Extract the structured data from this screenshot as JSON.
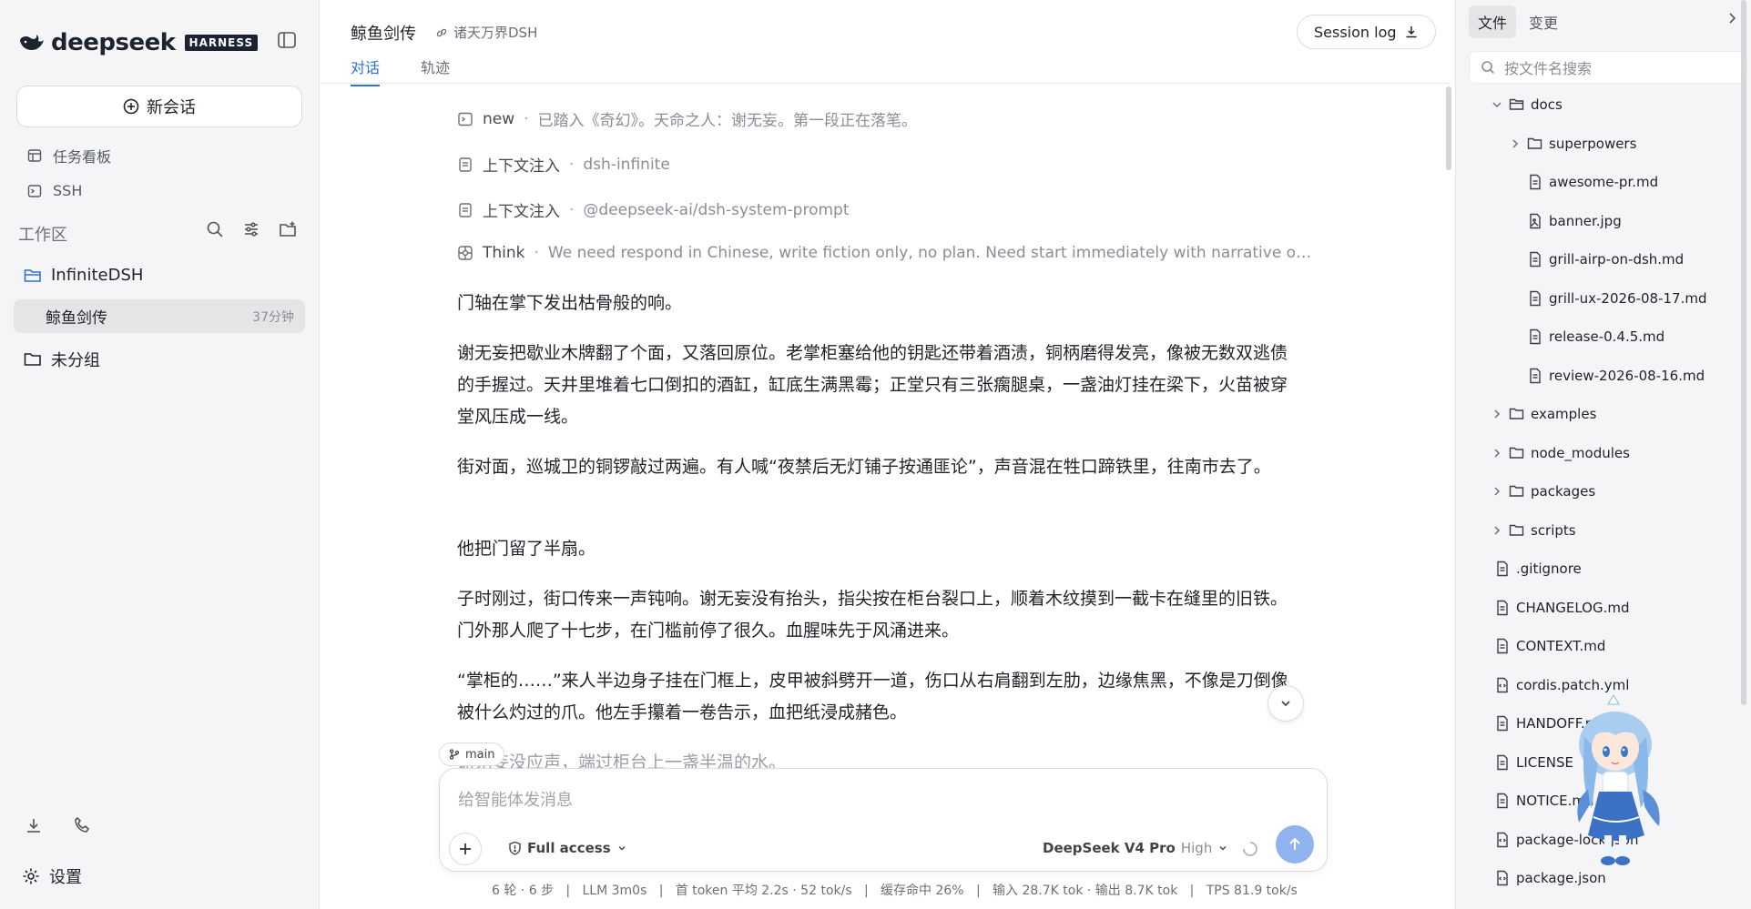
{
  "brand": {
    "name": "deepseek",
    "tag": "HARNESS"
  },
  "sidebar": {
    "new_chat": "新会话",
    "nav": [
      {
        "label": "任务看板",
        "icon": "board-icon"
      },
      {
        "label": "SSH",
        "icon": "terminal-icon"
      }
    ],
    "workspace_title": "工作区",
    "groups": [
      {
        "label": "InfiniteDSH",
        "open": true
      },
      {
        "label": "未分组",
        "open": false
      }
    ],
    "active_item": {
      "label": "鲸鱼剑传",
      "time": "37分钟"
    },
    "settings": "设置"
  },
  "header": {
    "title": "鲸鱼剑传",
    "project": "诸天万界DSH",
    "session_log": "Session log",
    "tabs": [
      {
        "label": "对话",
        "active": true
      },
      {
        "label": "轨迹",
        "active": false
      }
    ]
  },
  "feed": {
    "meta": [
      {
        "icon": "terminal-icon",
        "key": "new",
        "value": "已踏入《奇幻》。天命之人：谢无妄。第一段正在落笔。"
      },
      {
        "icon": "doc-icon",
        "key": "上下文注入",
        "value": "dsh-infinite"
      },
      {
        "icon": "doc-icon",
        "key": "上下文注入",
        "value": "@deepseek-ai/dsh-system-prompt"
      },
      {
        "icon": "think-icon",
        "key": "Think",
        "value": "We need respond in Chinese, write fiction only, no plan. Need start immediately with narrative or dialogue. ..."
      }
    ],
    "paragraphs": [
      "门轴在掌下发出枯骨般的响。",
      "谢无妄把歇业木牌翻了个面，又落回原位。老掌柜塞给他的钥匙还带着酒渍，铜柄磨得发亮，像被无数双逃债的手握过。天井里堆着七口倒扣的酒缸，缸底生满黑霉；正堂只有三张瘸腿桌，一盏油灯挂在梁下，火苗被穿堂风压成一线。",
      "街对面，巡城卫的铜锣敲过两遍。有人喊“夜禁后无灯铺子按通匪论”，声音混在牲口蹄铁里，往南市去了。",
      "他把门留了半扇。",
      "子时刚过，街口传来一声钝响。谢无妄没有抬头，指尖按在柜台裂口上，顺着木纹摸到一截卡在缝里的旧铁。门外那人爬了十七步，在门槛前停了很久。血腥味先于风涌进来。",
      "“掌柜的……”来人半边身子挂在门框上，皮甲被斜劈开一道，伤口从右肩翻到左肋，边缘焦黑，不像是刀倒像被什么灼过的爪。他左手攥着一卷告示，血把纸浸成赭色。",
      "谢无妄没应声，端过柜台上一盏半温的水。"
    ]
  },
  "composer": {
    "branch": "main",
    "placeholder": "给智能体发消息",
    "access": "Full access",
    "model": "DeepSeek V4 Pro",
    "level": "High"
  },
  "stats": "6 轮 · 6 步   |   LLM 3m0s   |   首 token 平均 2.2s · 52 tok/s   |   缓存命中 26%   |   输入 28.7K tok · 输出 8.7K tok   |   TPS 81.9 tok/s",
  "files_panel": {
    "tabs": [
      {
        "label": "文件",
        "active": true
      },
      {
        "label": "变更",
        "active": false
      }
    ],
    "search_placeholder": "按文件名搜索",
    "tree": [
      {
        "name": "docs",
        "type": "folder",
        "open": true,
        "depth": 1
      },
      {
        "name": "superpowers",
        "type": "folder",
        "open": false,
        "depth": 2
      },
      {
        "name": "awesome-pr.md",
        "type": "file",
        "depth": 2
      },
      {
        "name": "banner.jpg",
        "type": "image",
        "depth": 2
      },
      {
        "name": "grill-airp-on-dsh.md",
        "type": "file",
        "depth": 2
      },
      {
        "name": "grill-ux-2026-08-17.md",
        "type": "file",
        "depth": 2
      },
      {
        "name": "release-0.4.5.md",
        "type": "file",
        "depth": 2
      },
      {
        "name": "review-2026-08-16.md",
        "type": "file",
        "depth": 2
      },
      {
        "name": "examples",
        "type": "folder",
        "open": false,
        "depth": 1
      },
      {
        "name": "node_modules",
        "type": "folder",
        "open": false,
        "depth": 1
      },
      {
        "name": "packages",
        "type": "folder",
        "open": false,
        "depth": 1
      },
      {
        "name": "scripts",
        "type": "folder",
        "open": false,
        "depth": 1
      },
      {
        "name": ".gitignore",
        "type": "file",
        "depth": 0
      },
      {
        "name": "CHANGELOG.md",
        "type": "file",
        "depth": 0
      },
      {
        "name": "CONTEXT.md",
        "type": "file",
        "depth": 0
      },
      {
        "name": "cordis.patch.yml",
        "type": "code",
        "depth": 0
      },
      {
        "name": "HANDOFF.md",
        "type": "file",
        "depth": 0
      },
      {
        "name": "LICENSE",
        "type": "file",
        "depth": 0
      },
      {
        "name": "NOTICE.md",
        "type": "file",
        "depth": 0
      },
      {
        "name": "package-lock.json",
        "type": "code",
        "depth": 0
      },
      {
        "name": "package.json",
        "type": "code",
        "depth": 0
      }
    ]
  },
  "colors": {
    "accent": "#2f6fdc",
    "send": "#8fb3ee",
    "sidebar_bg": "#f5f5f7",
    "active_item": "#e5e5e8"
  }
}
